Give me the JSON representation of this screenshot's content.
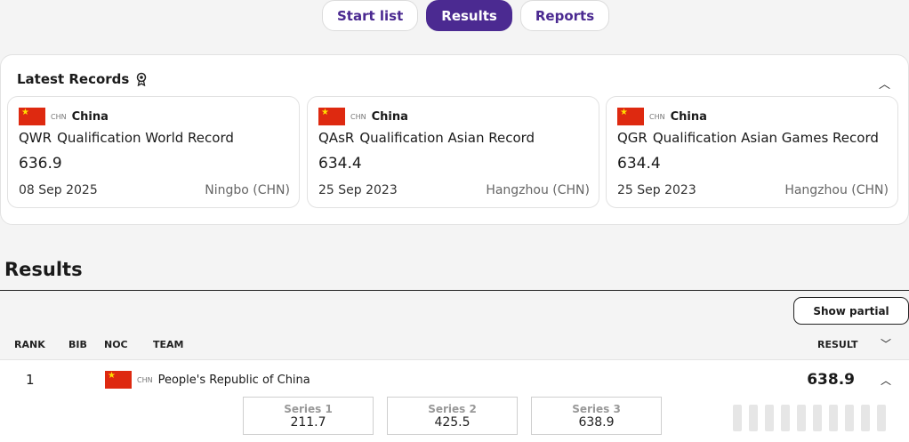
{
  "tabs": [
    {
      "label": "Start list",
      "active": false
    },
    {
      "label": "Results",
      "active": true
    },
    {
      "label": "Reports",
      "active": false
    }
  ],
  "records": {
    "title": "Latest Records",
    "collapse_icon": "chevron-up-icon",
    "items": [
      {
        "noc": "CHN",
        "country": "China",
        "abbr": "QWR",
        "type": "Qualification World Record",
        "score": "636.9",
        "date": "08 Sep 2025",
        "place": "Ningbo (CHN)"
      },
      {
        "noc": "CHN",
        "country": "China",
        "abbr": "QAsR",
        "type": "Qualification Asian Record",
        "score": "634.4",
        "date": "25 Sep 2023",
        "place": "Hangzhou (CHN)"
      },
      {
        "noc": "CHN",
        "country": "China",
        "abbr": "QGR",
        "type": "Qualification Asian Games Record",
        "score": "634.4",
        "date": "25 Sep 2023",
        "place": "Hangzhou (CHN)"
      }
    ]
  },
  "results": {
    "title": "Results",
    "show_partial_label": "Show partial",
    "columns": {
      "rank": "RANK",
      "bib": "BIB",
      "noc": "NOC",
      "team": "TEAM",
      "result": "RESULT"
    },
    "rows": [
      {
        "rank": "1",
        "noc": "CHN",
        "team": "People's Republic of China",
        "result": "638.9",
        "series": [
          {
            "label": "Series 1",
            "value": "211.7"
          },
          {
            "label": "Series 2",
            "value": "425.5"
          },
          {
            "label": "Series 3",
            "value": "638.9"
          }
        ]
      }
    ]
  },
  "colors": {
    "accent": "#4b2a91",
    "flag_red": "#de2910",
    "flag_star": "#ffde00"
  }
}
